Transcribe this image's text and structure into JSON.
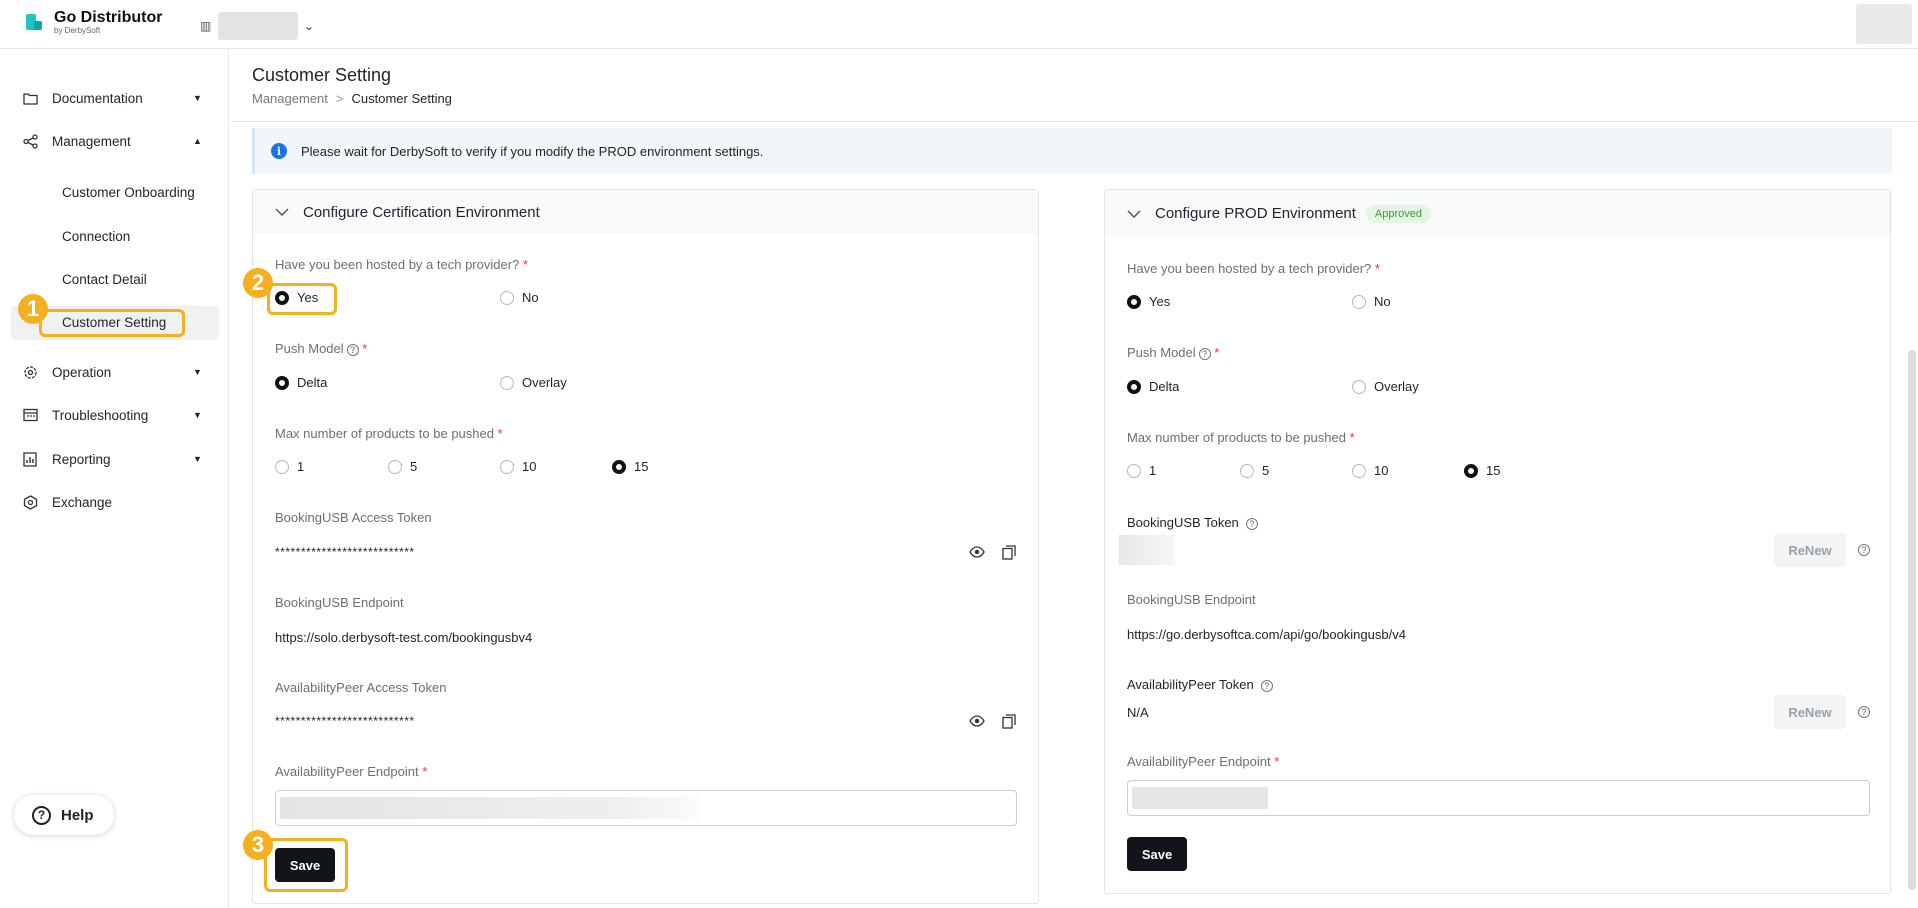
{
  "app": {
    "title": "Go Distributor",
    "subtitle": "by DerbySoft"
  },
  "sidebar": {
    "items": [
      {
        "label": "Documentation",
        "icon": "folder-icon"
      },
      {
        "label": "Management",
        "icon": "share-icon"
      },
      {
        "label": "Operation",
        "icon": "gear-icon"
      },
      {
        "label": "Troubleshooting",
        "icon": "calendar-icon"
      },
      {
        "label": "Reporting",
        "icon": "report-icon"
      },
      {
        "label": "Exchange",
        "icon": "exchange-icon"
      }
    ],
    "sub_items": [
      "Customer Onboarding",
      "Connection",
      "Contact Detail",
      "Customer Setting"
    ],
    "help": "Help"
  },
  "header": {
    "title": "Customer Setting",
    "breadcrumb": [
      "Management",
      ">",
      "Customer Setting"
    ]
  },
  "banner": {
    "text": "Please wait for DerbySoft to verify if you modify the PROD environment settings."
  },
  "callouts": [
    "1",
    "2",
    "3"
  ],
  "cert": {
    "title": "Configure Certification Environment",
    "hosted_label": "Have you been hosted by a tech provider?",
    "hosted_options": [
      "Yes",
      "No"
    ],
    "push_label": "Push Model",
    "push_options": [
      "Delta",
      "Overlay"
    ],
    "max_label": "Max number of products to be pushed",
    "max_options": [
      "1",
      "5",
      "10",
      "15"
    ],
    "booking_token_label": "BookingUSB Access Token",
    "booking_token_value": "***************************",
    "booking_endpoint_label": "BookingUSB Endpoint",
    "booking_endpoint_value": "https://solo.derbysoft-test.com/bookingusbv4",
    "avail_token_label": "AvailabilityPeer Access Token",
    "avail_token_value": "***************************",
    "avail_endpoint_label": "AvailabilityPeer Endpoint",
    "save": "Save"
  },
  "prod": {
    "title": "Configure PROD Environment",
    "status": "Approved",
    "hosted_label": "Have you been hosted by a tech provider?",
    "hosted_options": [
      "Yes",
      "No"
    ],
    "push_label": "Push Model",
    "push_options": [
      "Delta",
      "Overlay"
    ],
    "max_label": "Max number of products to be pushed",
    "max_options": [
      "1",
      "5",
      "10",
      "15"
    ],
    "booking_token_label": "BookingUSB Token",
    "renew": "ReNew",
    "booking_endpoint_label": "BookingUSB Endpoint",
    "booking_endpoint_value": "https://go.derbysoftca.com/api/go/bookingusb/v4",
    "avail_token_label": "AvailabilityPeer Token",
    "avail_token_value": "N/A",
    "avail_endpoint_label": "AvailabilityPeer Endpoint",
    "save": "Save"
  },
  "required_mark": "*",
  "colors": {
    "accent": "#f4b01e",
    "primary_button": "#11151a",
    "approved": "#3c9a35"
  }
}
